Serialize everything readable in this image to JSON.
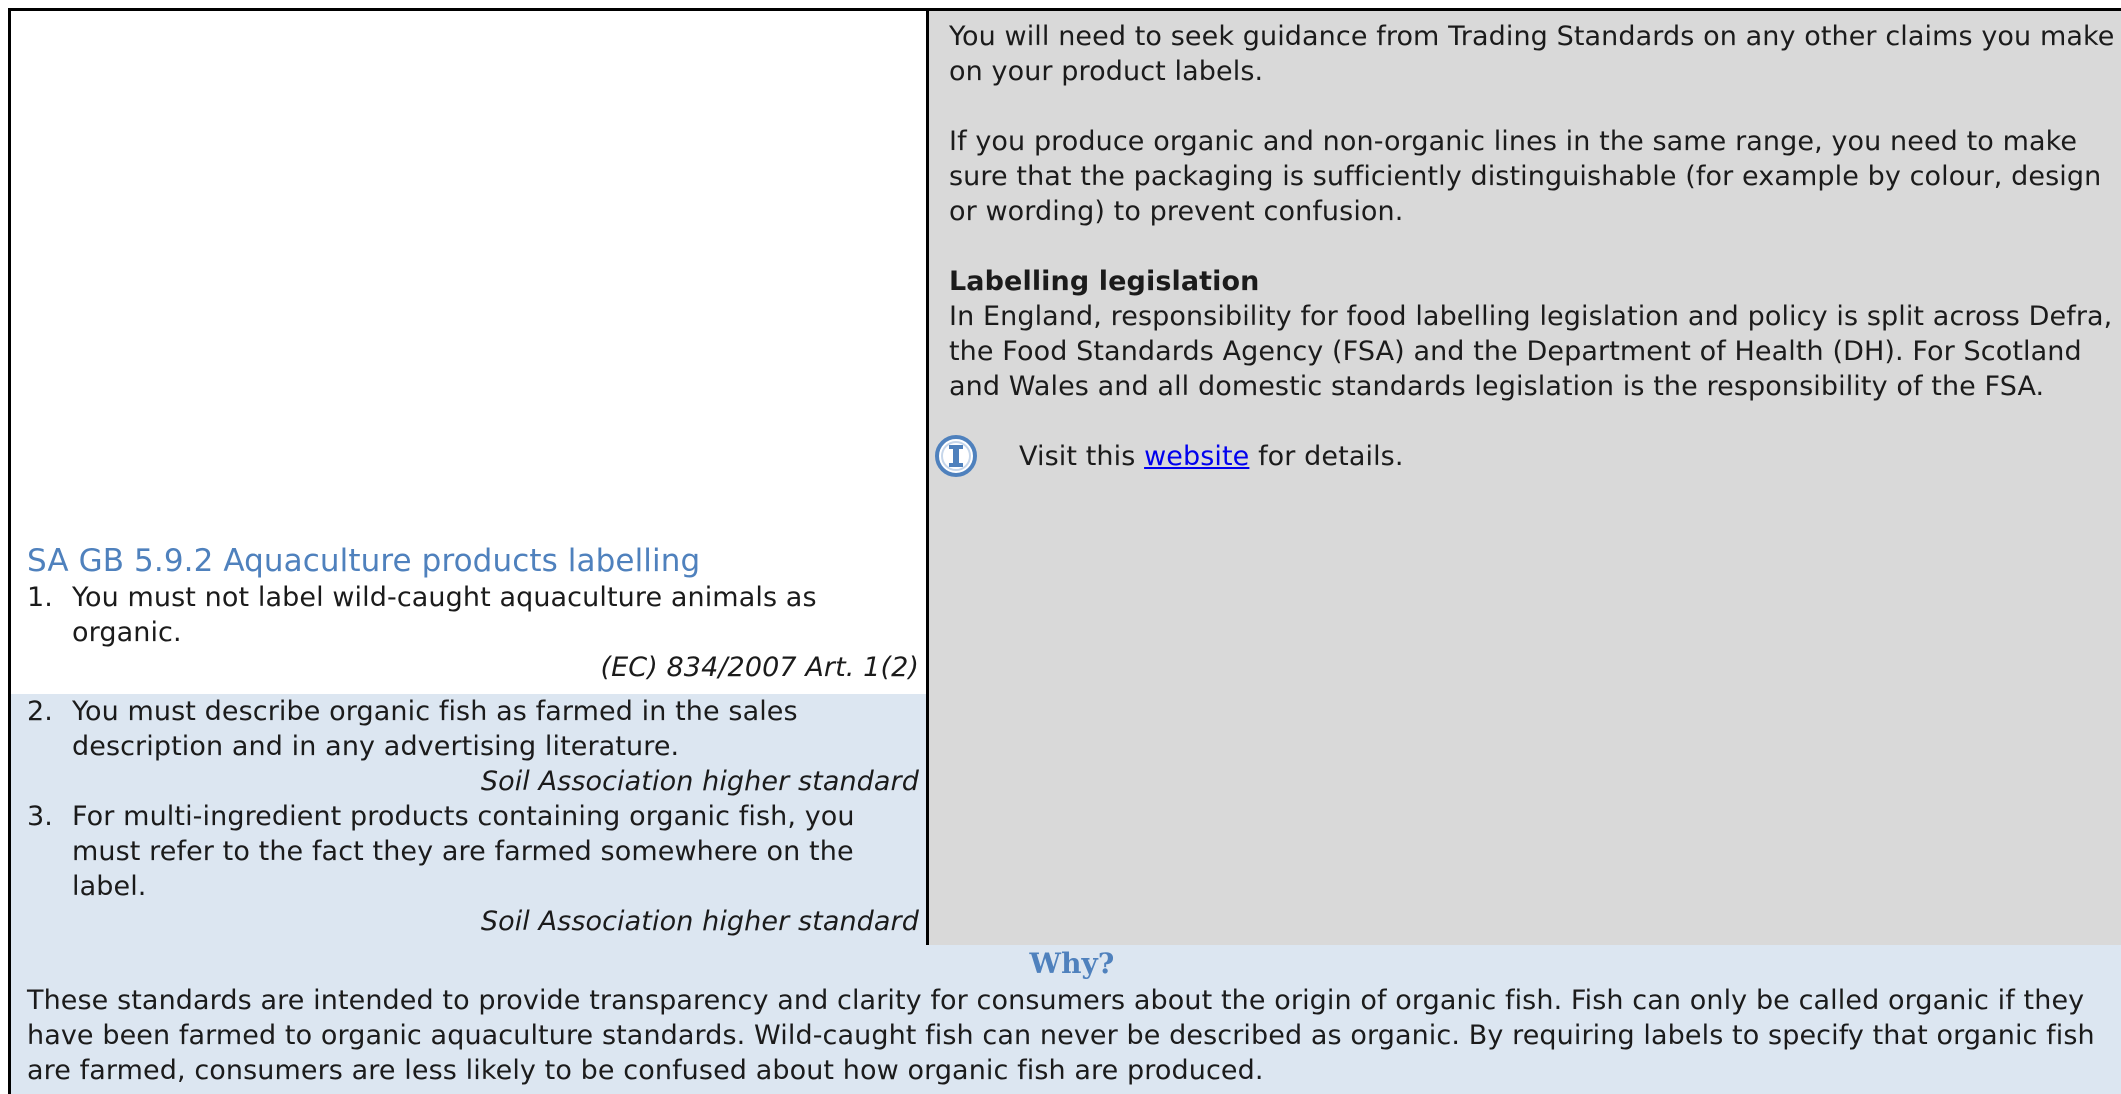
{
  "top_right": {
    "para1": "You will need to seek guidance from Trading Standards on any other claims you make on your product labels.",
    "para2": "If you produce organic and non-organic lines in the same range, you need to make sure that the packaging is sufficiently distinguishable (for example by colour, design or wording) to prevent confusion.",
    "heading": "Labelling legislation",
    "para3": "In England, responsibility for food labelling legislation and policy is split across Defra, the Food Standards Agency (FSA) and the Department of Health (DH). For Scotland and Wales and all domestic standards legislation is the responsibility of the FSA.",
    "visit_prefix": "Visit this ",
    "visit_link": "website",
    "visit_suffix": " for details.",
    "icon": "info-icon"
  },
  "standard": {
    "title": "SA GB 5.9.2 Aquaculture products labelling",
    "items": [
      {
        "num": "1.",
        "text": "You must not label wild-caught aquaculture animals as organic.",
        "reference": "(EC) 834/2007 Art. 1(2)"
      },
      {
        "num": "2.",
        "text": "You must describe organic fish as farmed in the sales description and in any advertising literature.",
        "reference": "Soil Association higher standard"
      },
      {
        "num": "3.",
        "text": "For multi-ingredient products containing organic fish, you must refer to the fact they are farmed somewhere on the label.",
        "reference": "Soil Association higher standard"
      }
    ]
  },
  "why": {
    "heading": "Why?",
    "text": "These standards are intended to provide transparency and clarity for consumers about the origin of organic fish. Fish can only be called organic if they have been farmed to organic aquaculture standards. Wild-caught fish can never be described as organic. By requiring labels to specify that organic fish are farmed, consumers are less likely to be confused about how organic fish are produced."
  },
  "colors": {
    "grey_panel": "#d9d9d9",
    "blue_panel": "#dce6f1",
    "accent": "#4f81bd",
    "link": "#0000ee"
  }
}
